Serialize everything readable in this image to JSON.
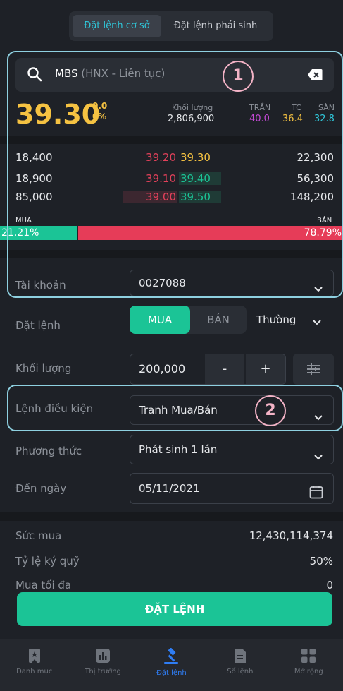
{
  "tabs": {
    "active": "Đặt lệnh cơ sở",
    "inactive": "Đặt lệnh phái sinh"
  },
  "annotations": {
    "one": "1",
    "two": "2"
  },
  "search": {
    "symbol": "MBS",
    "exchange": "(HNX - Liên tục)"
  },
  "quote": {
    "price": "39.30",
    "change": "0.0",
    "change_pct": "0%",
    "volume_label": "Khối lượng",
    "volume": "2,806,900",
    "ceiling_label": "TRẦN",
    "ceiling": "40.0",
    "ref_label": "TC",
    "ref": "36.4",
    "floor_label": "SÀN",
    "floor": "32.8"
  },
  "orderbook": [
    {
      "bid_vol": "18,400",
      "bid": "39.20",
      "ask": "39.30",
      "ask_vol": "22,300"
    },
    {
      "bid_vol": "18,900",
      "bid": "39.10",
      "ask": "39.40",
      "ask_vol": "56,300"
    },
    {
      "bid_vol": "85,000",
      "bid": "39.00",
      "ask": "39.50",
      "ask_vol": "148,200"
    }
  ],
  "ratio": {
    "buy_label": "MUA",
    "buy": "21.21%",
    "sell_label": "BÁN",
    "sell": "78.79%",
    "buy_fraction": 0.2121
  },
  "form": {
    "account_label": "Tài khoản",
    "account": "0027088",
    "order_label": "Đặt lệnh",
    "buy": "MUA",
    "sell": "BÁN",
    "order_type": "Thường",
    "qty_label": "Khối lượng",
    "qty": "200,000",
    "minus": "-",
    "plus": "+",
    "cond_label": "Lệnh điều kiện",
    "cond": "Tranh Mua/Bán",
    "method_label": "Phương thức",
    "method": "Phát sinh 1 lần",
    "date_label": "Đến ngày",
    "date": "05/11/2021"
  },
  "info": {
    "power_label": "Sức mua",
    "power": "12,430,114,374",
    "margin_label": "Tỷ lệ ký quỹ",
    "margin": "50%",
    "max_label": "Mua tối đa",
    "max": "0"
  },
  "submit": "ĐẶT LỆNH",
  "nav": [
    "Danh mục",
    "Thị trường",
    "Đặt lệnh",
    "Sổ lệnh",
    "Mở rộng"
  ],
  "colors": {
    "green": "#1bc496",
    "red": "#e63c58",
    "yellow": "#f5c242",
    "purple": "#c64ad8",
    "cyan": "#2fc5d8",
    "accent": "#2f7df4"
  }
}
